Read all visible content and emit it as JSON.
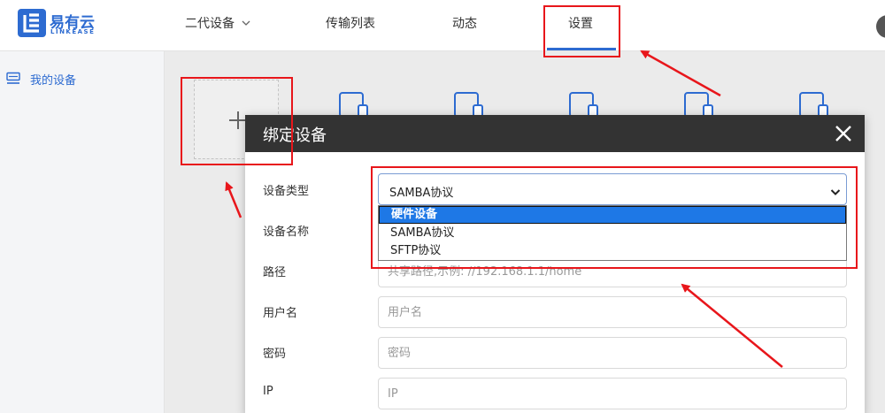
{
  "app": {
    "logo_name": "易有云",
    "logo_sub": "LINKEASE",
    "brand_color": "#2d6bd1"
  },
  "nav": {
    "devices": "二代设备",
    "transfer": "传输列表",
    "dynamic": "动态",
    "settings": "设置",
    "active": "设置"
  },
  "sidebar": {
    "items": [
      {
        "label": "我的设备",
        "icon": "device-list-icon"
      }
    ]
  },
  "modal": {
    "title": "绑定设备",
    "fields": {
      "device_type": {
        "label": "设备类型",
        "value": "SAMBA协议",
        "options": [
          "硬件设备",
          "SAMBA协议",
          "SFTP协议"
        ],
        "highlighted_option": "硬件设备"
      },
      "device_name": {
        "label": "设备名称"
      },
      "path": {
        "label": "路径",
        "placeholder": "共享路径,示例: //192.168.1.1/home"
      },
      "username": {
        "label": "用户名",
        "placeholder": "用户名"
      },
      "password": {
        "label": "密码",
        "placeholder": "密码"
      },
      "ip": {
        "label": "IP",
        "placeholder": "IP"
      }
    }
  },
  "annotation_color": "#e8161b"
}
